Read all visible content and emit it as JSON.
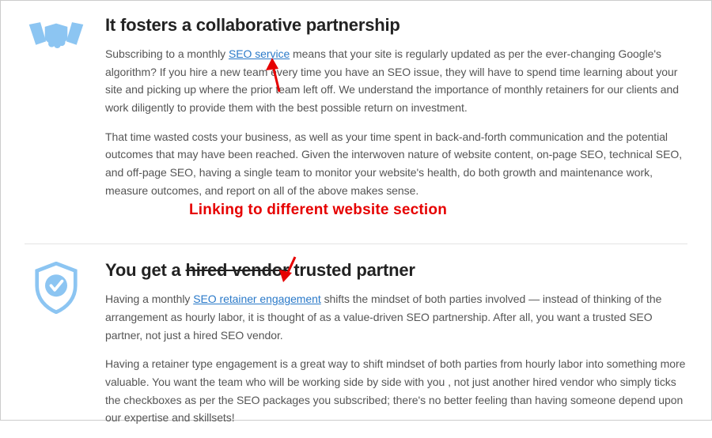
{
  "section1": {
    "heading": "It fosters a collaborative partnership",
    "p1a": "Subscribing to a monthly ",
    "link1": "SEO service",
    "p1b": " means that your site is regularly updated as per the ever-changing Google's algorithm? If you hire a new team every time you have an SEO issue, they will have to spend time learning about your site and picking up where the prior team left off. We understand the importance of monthly retainers for our clients and work diligently to provide them with the best possible return on investment.",
    "p2": "That time wasted costs your business, as well as your time spent in back-and-forth communication and the potential outcomes that may have been reached. Given the interwoven nature of website content, on-page SEO, technical SEO, and off-page SEO, having a single team to monitor your website's health, do both growth and maintenance work, measure outcomes, and report on all of the above makes sense."
  },
  "annotation": {
    "text": "Linking to different website section"
  },
  "section2": {
    "heading_a": "You get a ",
    "heading_strike": "hired vendor",
    "heading_b": " trusted partner",
    "p1a": "Having a monthly ",
    "link1": "SEO retainer engagement",
    "p1b": " shifts the mindset of both parties involved — instead of thinking of the arrangement as hourly labor, it is thought of as a value-driven SEO partnership. After all, you want a trusted SEO partner, not just a hired SEO vendor.",
    "p2": "Having a retainer type engagement is a great way to shift mindset of both parties from hourly labor into something more valuable. You want the team who will be working side by side with you , not just another hired vendor who simply ticks the checkboxes as per the SEO packages you subscribed; there's no better feeling than having someone depend upon our expertise and skillsets!"
  }
}
